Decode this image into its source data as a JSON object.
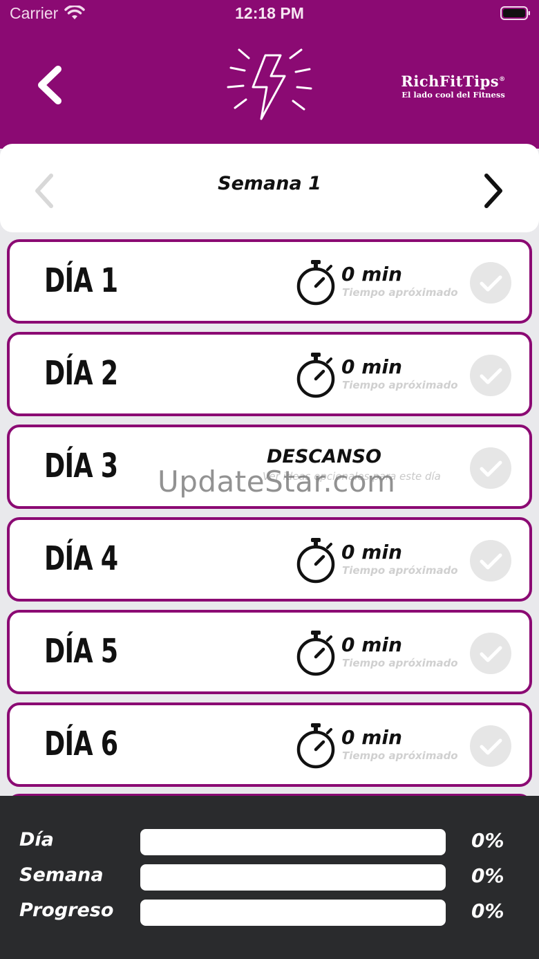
{
  "status_bar": {
    "carrier": "Carrier",
    "time": "12:18 PM"
  },
  "header": {
    "brand_name": "RichFitTips",
    "brand_mark": "®",
    "brand_tagline": "El lado cool del Fitness",
    "icons": {
      "back": "chevron-left-icon",
      "logo": "lightning-bolt-icon"
    }
  },
  "week": {
    "title": "Semana 1",
    "prev_enabled": false,
    "next_enabled": true
  },
  "days": [
    {
      "label": "DÍA 1",
      "type": "workout",
      "duration": "0 min",
      "subtitle": "Tiempo apróximado",
      "completed": false
    },
    {
      "label": "DÍA 2",
      "type": "workout",
      "duration": "0 min",
      "subtitle": "Tiempo apróximado",
      "completed": false
    },
    {
      "label": "DÍA 3",
      "type": "rest",
      "title": "DESCANSO",
      "subtitle": "Ver ideas opcionales para este día",
      "completed": false
    },
    {
      "label": "DÍA 4",
      "type": "workout",
      "duration": "0 min",
      "subtitle": "Tiempo apróximado",
      "completed": false
    },
    {
      "label": "DÍA 5",
      "type": "workout",
      "duration": "0 min",
      "subtitle": "Tiempo apróximado",
      "completed": false
    },
    {
      "label": "DÍA 6",
      "type": "workout",
      "duration": "0 min",
      "subtitle": "Tiempo apróximado",
      "completed": false
    }
  ],
  "watermark": "UpdateStar.com",
  "progress": [
    {
      "label": "Día",
      "percent": 0,
      "value": "0%"
    },
    {
      "label": "Semana",
      "percent": 0,
      "value": "0%"
    },
    {
      "label": "Progreso",
      "percent": 0,
      "value": "0%"
    }
  ],
  "colors": {
    "accent": "#8b0a73",
    "footer": "#2a2b2d",
    "background": "#e9e9ec"
  }
}
